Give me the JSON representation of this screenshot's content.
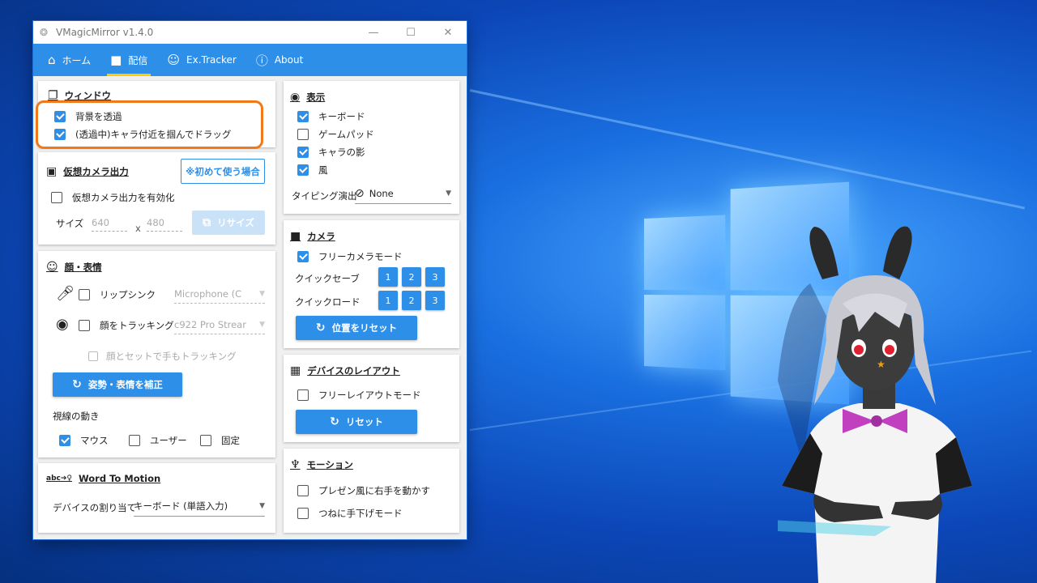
{
  "window": {
    "title": "VMagicMirror v1.4.0",
    "controls": {
      "minimize": "—",
      "maximize": "☐",
      "close": "✕"
    }
  },
  "nav": {
    "tabs": [
      {
        "label": "ホーム",
        "icon": "home-icon"
      },
      {
        "label": "配信",
        "icon": "video-camera-icon"
      },
      {
        "label": "Ex.Tracker",
        "icon": "face-scan-icon"
      },
      {
        "label": "About",
        "icon": "help-circle-icon"
      }
    ],
    "active": "配信"
  },
  "window_section": {
    "title": "ウィンドウ",
    "transparent_bg": {
      "label": "背景を透過",
      "checked": true
    },
    "drag_char": {
      "label": "(透過中)キャラ付近を掴んでドラッグ",
      "checked": true
    }
  },
  "virtual_camera": {
    "title": "仮想カメラ出力",
    "first_time_button": "※初めて使う場合",
    "enable": {
      "label": "仮想カメラ出力を有効化",
      "checked": false
    },
    "size_label": "サイズ",
    "width": "640",
    "x_label": "x",
    "height": "480",
    "resize_button": "リサイズ"
  },
  "face": {
    "title": "顔・表情",
    "lipsync": {
      "label": "リップシンク",
      "checked": false,
      "device": "Microphone (C"
    },
    "face_tracking": {
      "label": "顔をトラッキング",
      "checked": false,
      "device": "c922 Pro Strear"
    },
    "hand_tracking": {
      "label": "顔とセットで手もトラッキング",
      "checked": false
    },
    "calibrate_button": "姿勢・表情を補正",
    "gaze_title": "視線の動き",
    "gaze_mouse": {
      "label": "マウス",
      "checked": true
    },
    "gaze_user": {
      "label": "ユーザー",
      "checked": false
    },
    "gaze_fixed": {
      "label": "固定",
      "checked": false
    }
  },
  "word_to_motion": {
    "title": "Word To Motion",
    "device_label": "デバイスの割り当て",
    "device_value": "キーボード (単語入力)"
  },
  "display": {
    "title": "表示",
    "keyboard": {
      "label": "キーボード",
      "checked": true
    },
    "gamepad": {
      "label": "ゲームパッド",
      "checked": false
    },
    "shadow": {
      "label": "キャラの影",
      "checked": true
    },
    "wind": {
      "label": "風",
      "checked": true
    },
    "typing_label": "タイピング演出",
    "typing_value": "None"
  },
  "camera": {
    "title": "カメラ",
    "free_camera": {
      "label": "フリーカメラモード",
      "checked": true
    },
    "quick_save": "クイックセーブ",
    "quick_load": "クイックロード",
    "slots": [
      "1",
      "2",
      "3"
    ],
    "reset_button": "位置をリセット"
  },
  "device_layout": {
    "title": "デバイスのレイアウト",
    "free_layout": {
      "label": "フリーレイアウトモード",
      "checked": false
    },
    "reset_button": "リセット"
  },
  "motion": {
    "title": "モーション",
    "present": {
      "label": "プレゼン風に右手を動かす",
      "checked": false
    },
    "hands_down": {
      "label": "つねに手下げモード",
      "checked": false
    }
  },
  "colors": {
    "accent": "#2d8fe8",
    "highlight": "#f07a1a",
    "tab_underline": "#ffcc00"
  }
}
